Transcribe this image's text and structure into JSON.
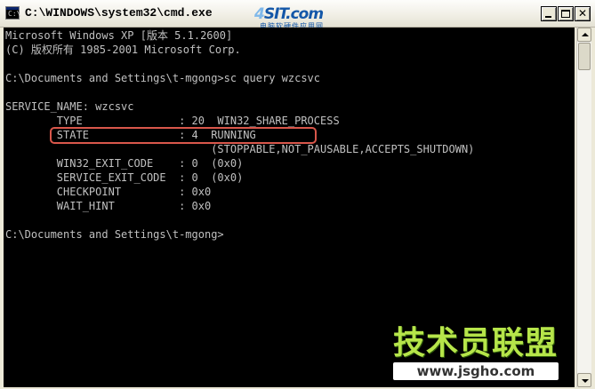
{
  "window": {
    "title": "C:\\WINDOWS\\system32\\cmd.exe",
    "app_icon_label": "C:\\",
    "icons": {
      "app": "cmd-icon",
      "minimize": "minimize-icon",
      "maximize": "maximize-icon",
      "close": "close-icon"
    },
    "controls": {
      "close_glyph": "✕"
    }
  },
  "brand_logo": {
    "name_prefix": "4",
    "name_main": "SIT.com",
    "tagline": "电脑软硬件应用网"
  },
  "console": {
    "lines": [
      "Microsoft Windows XP [版本 5.1.2600]",
      "(C) 版权所有 1985-2001 Microsoft Corp.",
      "",
      "C:\\Documents and Settings\\t-mgong>sc query wzcsvc",
      "",
      "SERVICE_NAME: wzcsvc",
      "        TYPE               : 20  WIN32_SHARE_PROCESS",
      "        STATE              : 4  RUNNING",
      "                                (STOPPABLE,NOT_PAUSABLE,ACCEPTS_SHUTDOWN)",
      "        WIN32_EXIT_CODE    : 0  (0x0)",
      "        SERVICE_EXIT_CODE  : 0  (0x0)",
      "        CHECKPOINT         : 0x0",
      "        WAIT_HINT          : 0x0",
      "",
      "C:\\Documents and Settings\\t-mgong>"
    ],
    "highlighted_line": "STATE",
    "colors": {
      "background": "#000000",
      "text": "#c0c0c0",
      "highlight": "#d9574b"
    }
  },
  "watermark": {
    "title": "技术员联盟",
    "url": "www.jsgho.com"
  }
}
